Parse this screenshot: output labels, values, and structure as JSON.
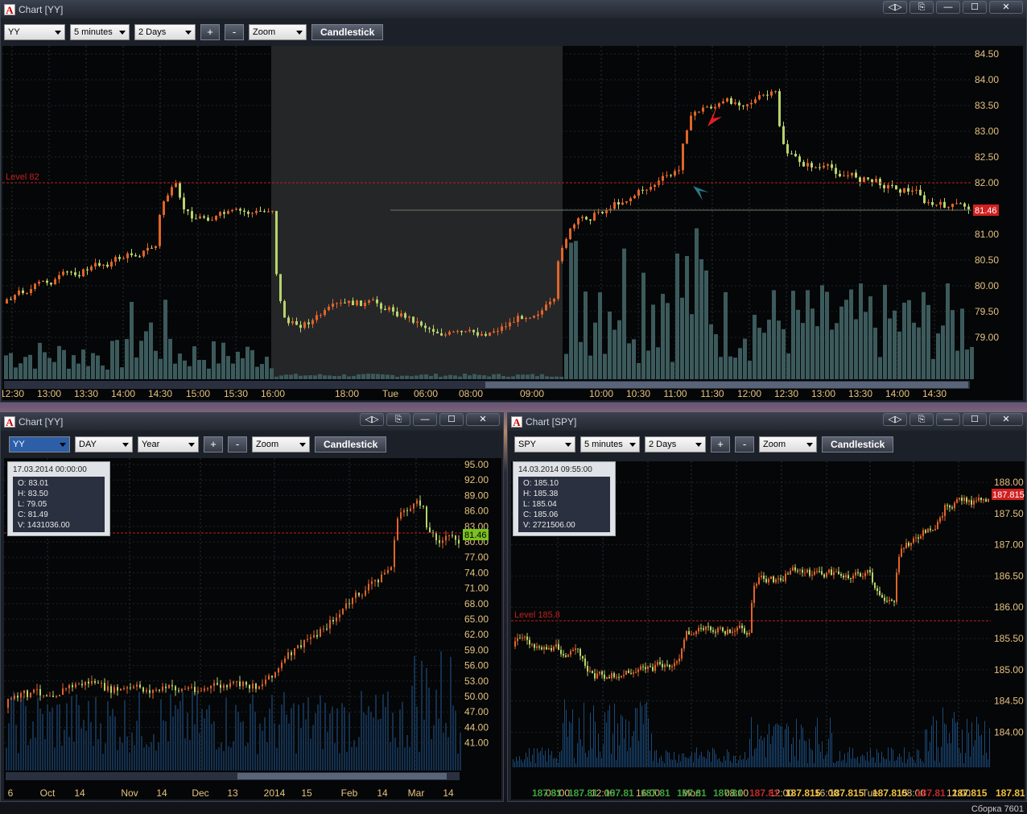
{
  "main_window": {
    "title": "Chart [YY]",
    "buttons": [
      "◁▷",
      "⎘",
      "—",
      "☐",
      "✕"
    ],
    "toolbar": {
      "symbol": "YY",
      "interval": "5 minutes",
      "period": "2 Days",
      "plus": "+",
      "minus": "-",
      "zoom": "Zoom",
      "type": "Candlestick"
    },
    "level_label": "Level 82",
    "price_tag": "81.46",
    "y_ticks": [
      "84.50",
      "84.00",
      "83.50",
      "83.00",
      "82.50",
      "82.00",
      "81.50",
      "81.00",
      "80.50",
      "80.00",
      "79.50",
      "79.00"
    ],
    "x_ticks": [
      "12:30",
      "13:00",
      "13:30",
      "14:00",
      "14:30",
      "15:00",
      "15:30",
      "16:00",
      "18:00",
      "Tue",
      "06:00",
      "08:00",
      "09:00",
      "10:00",
      "10:30",
      "11:00",
      "11:30",
      "12:00",
      "12:30",
      "13:00",
      "13:30",
      "14:00",
      "14:30"
    ]
  },
  "bottom_left_window": {
    "title": "Chart [YY]",
    "toolbar": {
      "symbol": "YY",
      "interval": "DAY",
      "period": "Year",
      "plus": "+",
      "minus": "-",
      "zoom": "Zoom",
      "type": "Candlestick"
    },
    "info": {
      "date": "17.03.2014 00:00:00",
      "o": "O: 83.01",
      "h": "H: 83.50",
      "l": "L: 79.05",
      "c": "C: 81.49",
      "v": "V: 1431036.00"
    },
    "price_tag": "81.46",
    "y_ticks": [
      "95.00",
      "92.00",
      "89.00",
      "86.00",
      "83.00",
      "80.00",
      "77.00",
      "74.00",
      "71.00",
      "68.00",
      "65.00",
      "62.00",
      "59.00",
      "56.00",
      "53.00",
      "50.00",
      "47.00",
      "44.00",
      "41.00"
    ],
    "x_ticks": [
      "6",
      "Oct",
      "14",
      "Nov",
      "14",
      "Dec",
      "13",
      "2014",
      "15",
      "Feb",
      "14",
      "Mar",
      "14"
    ]
  },
  "bottom_right_window": {
    "title": "Chart [SPY]",
    "toolbar": {
      "symbol": "SPY",
      "interval": "5 minutes",
      "period": "2 Days",
      "plus": "+",
      "minus": "-",
      "zoom": "Zoom",
      "type": "Candlestick"
    },
    "info": {
      "date": "14.03.2014 09:55:00",
      "o": "O: 185.10",
      "h": "H: 185.38",
      "l": "L: 185.04",
      "c": "C: 185.06",
      "v": "V: 2721506.00"
    },
    "level_label": "Level 185.8",
    "price_tag": "187.815",
    "y_ticks": [
      "188.00",
      "187.50",
      "187.00",
      "186.50",
      "186.00",
      "185.50",
      "185.00",
      "184.50",
      "184.00"
    ],
    "x_ticks": [
      "08:00",
      "12:00",
      "16:00",
      "Mon",
      "08:00",
      "12:00",
      "16:00",
      "Tue",
      "08:00",
      "12:00"
    ],
    "bottom_prices": [
      {
        "v": "187.81",
        "c": "#3ea23e"
      },
      {
        "v": "187.81",
        "c": "#3ea23e"
      },
      {
        "v": "187.81",
        "c": "#3ea23e"
      },
      {
        "v": "187.81",
        "c": "#3ea23e"
      },
      {
        "v": "187.81",
        "c": "#3ea23e"
      },
      {
        "v": "187.81",
        "c": "#3ea23e"
      },
      {
        "v": "187.81",
        "c": "#c02828"
      },
      {
        "v": "187.815",
        "c": "#f0c040"
      },
      {
        "v": "187.815",
        "c": "#f0c040"
      },
      {
        "v": "187.815",
        "c": "#f0c040"
      },
      {
        "v": "187.81",
        "c": "#c02828"
      },
      {
        "v": "187.815",
        "c": "#f0c040"
      },
      {
        "v": "187.815",
        "c": "#f0c040"
      },
      {
        "v": "187.815",
        "c": "#f0c040"
      }
    ]
  },
  "footer": "Сборка 7601",
  "colors": {
    "up": "#b8d46a",
    "down": "#e0642a",
    "volume": "#3c5a5c",
    "level": "#c02020",
    "axis": "#e6c280"
  }
}
